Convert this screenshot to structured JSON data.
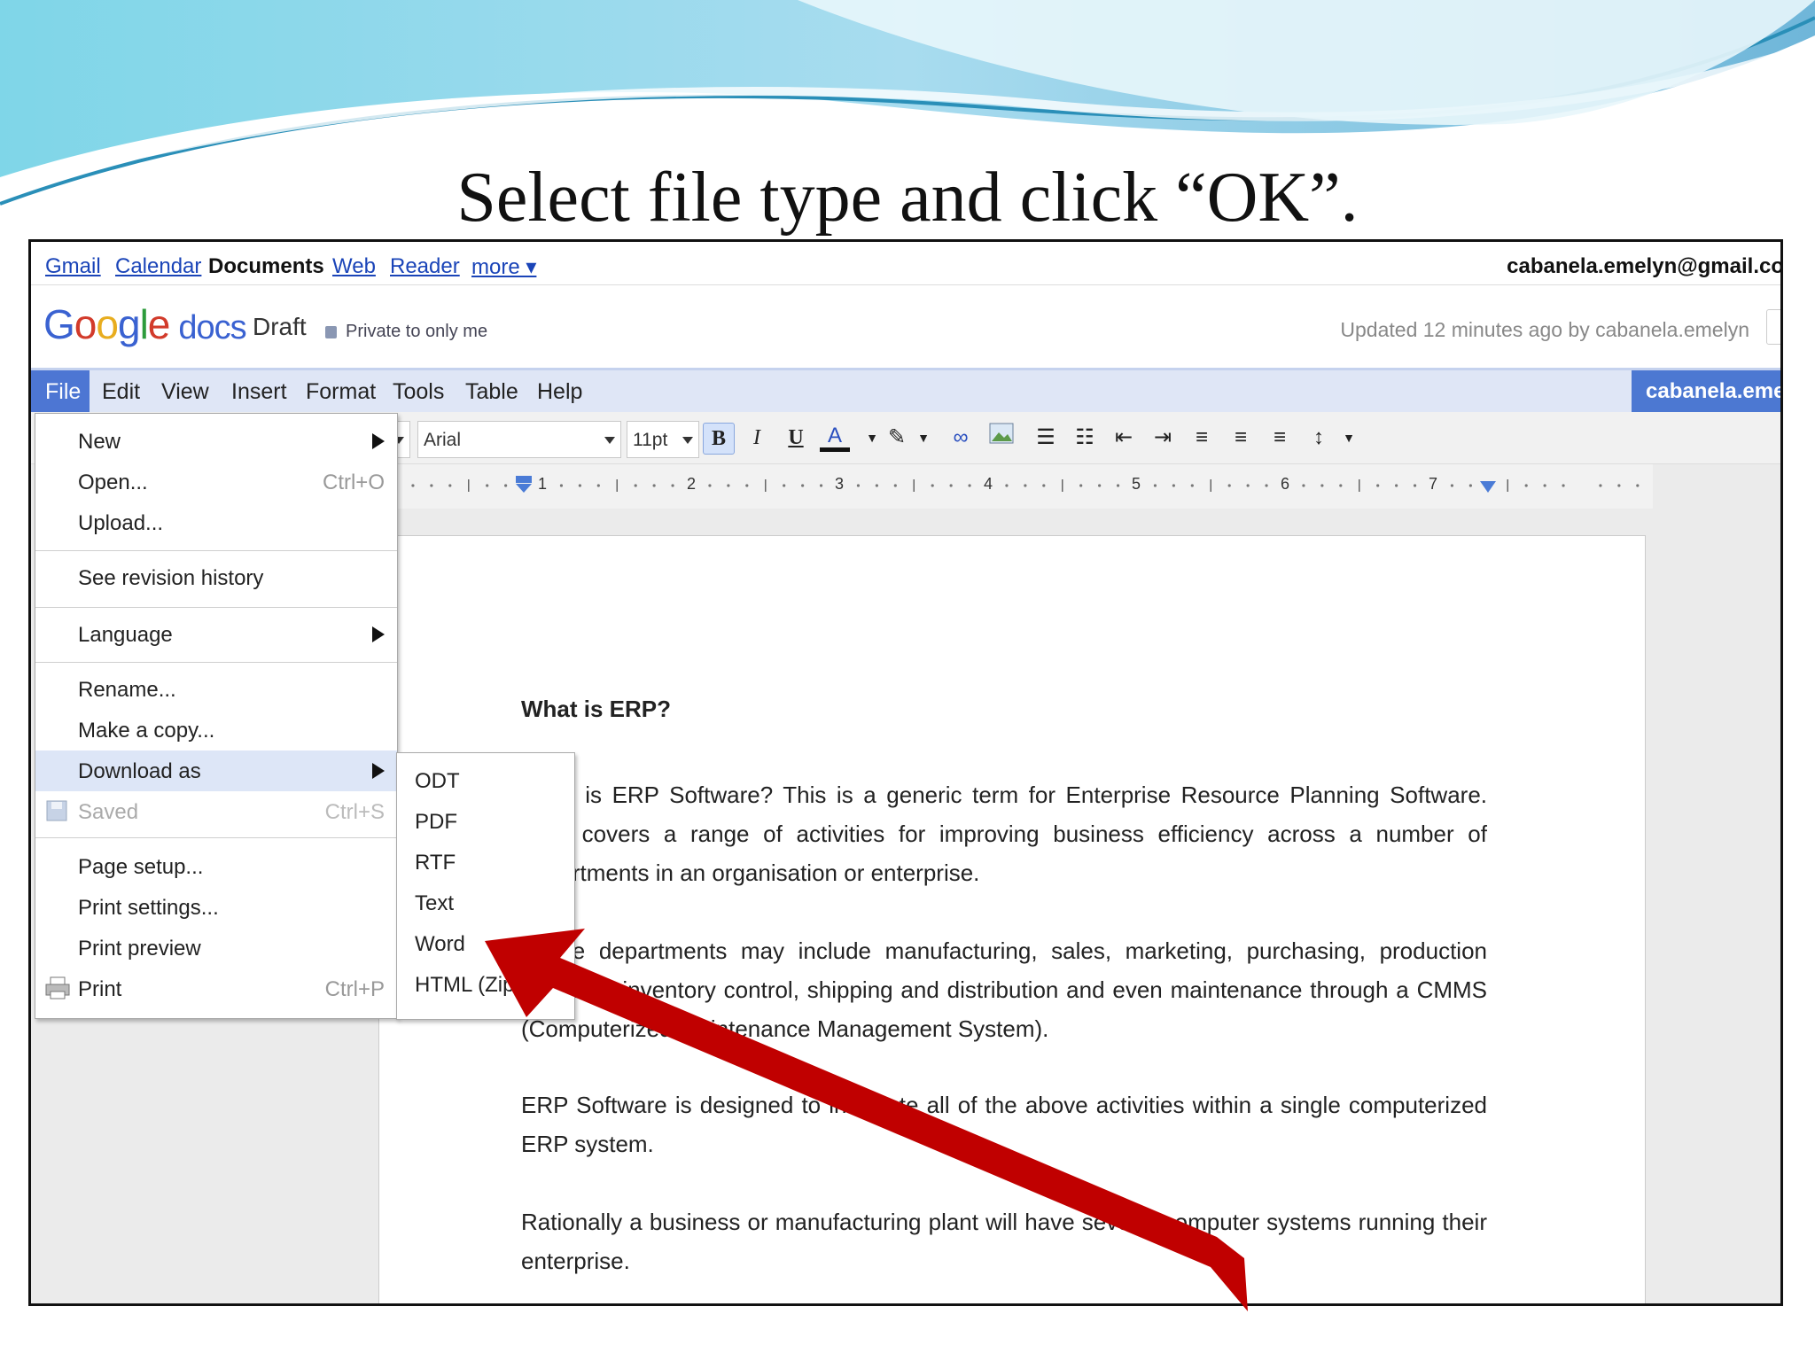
{
  "slide_title": "Select file type and click “OK”.",
  "gbar": {
    "links": [
      "Gmail",
      "Calendar",
      "Documents",
      "Web",
      "Reader",
      "more ▾"
    ],
    "active": "Documents",
    "user_email": "cabanela.emelyn@gmail.co"
  },
  "header": {
    "logo_google": "Google",
    "logo_docs": "docs",
    "doc_title": "Draft",
    "privacy": "Private to only me",
    "updated": "Updated 12 minutes ago by cabanela.emelyn"
  },
  "menubar": {
    "items": [
      "File",
      "Edit",
      "View",
      "Insert",
      "Format",
      "Tools",
      "Table",
      "Help"
    ],
    "share_label": "cabanela.eme"
  },
  "toolbar": {
    "font": "Arial",
    "size": "11pt",
    "bold": "B",
    "italic": "I",
    "underline": "U",
    "text_color": "A"
  },
  "ruler": {
    "labels": [
      "1",
      "2",
      "3",
      "4",
      "5",
      "6",
      "7"
    ]
  },
  "file_menu": {
    "new": "New",
    "open": "Open...",
    "open_shortcut": "Ctrl+O",
    "upload": "Upload...",
    "revision": "See revision history",
    "language": "Language",
    "rename": "Rename...",
    "copy": "Make a copy...",
    "download": "Download as",
    "saved": "Saved",
    "saved_shortcut": "Ctrl+S",
    "page_setup": "Page setup...",
    "print_settings": "Print settings...",
    "print_preview": "Print preview",
    "print": "Print",
    "print_shortcut": "Ctrl+P"
  },
  "download_submenu": [
    "ODT",
    "PDF",
    "RTF",
    "Text",
    "Word",
    "HTML (Zip)"
  ],
  "document": {
    "heading": "What is ERP?",
    "paragraphs": [
      "What is ERP Software? This is a generic term for Enterprise Resource Planning Software. ERP covers a range of activities for improving business efficiency across a number of departments in an organisation or enterprise.",
      "These departments may include manufacturing, sales, marketing, purchasing, production planning, inventory control, shipping and distribution and even maintenance through a CMMS (Computerized Maintenance Management System).",
      "ERP Software is designed to integrate all of the above activities within a single computerized ERP system.",
      "Rationally a business or manufacturing plant will have several computer systems running their enterprise."
    ]
  },
  "colors": {
    "menubar_bg": "#dfe6f6",
    "file_active": "#4d76d3",
    "arrow": "#c00000",
    "link": "#1a44b8"
  }
}
